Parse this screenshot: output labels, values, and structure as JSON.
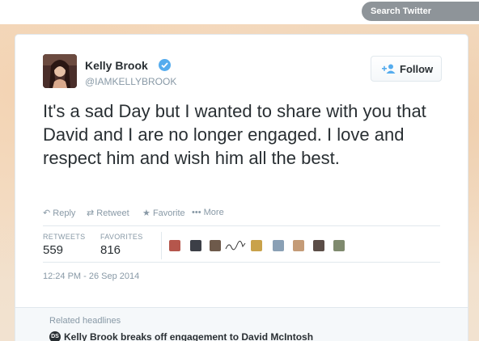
{
  "header": {
    "search_placeholder": "Search Twitter"
  },
  "tweet": {
    "author_name": "Kelly Brook",
    "handle": "@IAMKELLYBROOK",
    "verified": true,
    "follow_label": "Follow",
    "text": "It's a sad Day but I wanted to share with you that David and I are no longer engaged. I love and respect him and wish him all the best.",
    "actions": {
      "reply": "Reply",
      "retweet": "Retweet",
      "favorite": "Favorite",
      "more": "More"
    },
    "stats": {
      "retweets_label": "RETWEETS",
      "retweets_value": "559",
      "favorites_label": "FAVORITES",
      "favorites_value": "816"
    },
    "timestamp": "12:24 PM - 26 Sep 2014"
  },
  "related": {
    "title": "Related headlines",
    "badge": "DS",
    "headline": "Kelly Brook breaks off engagement to David McIntosh"
  },
  "colors": {
    "accent": "#55acee",
    "text": "#292f33",
    "muted": "#8899a6",
    "border": "#e1e8ed"
  }
}
